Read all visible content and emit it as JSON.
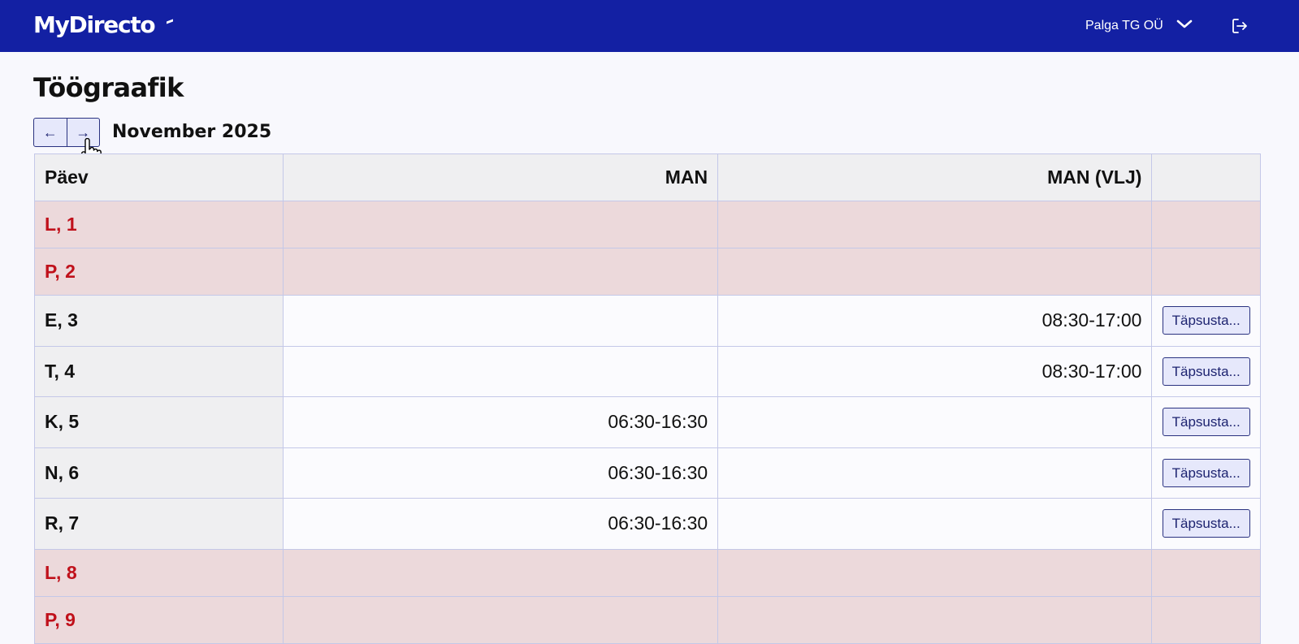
{
  "header": {
    "logo_text": "MyDirecto",
    "company_name": "Palga TG OÜ",
    "background_color": "#1320a3",
    "company_dropdown_icon": "chevron-down-icon",
    "logout_icon": "logout-icon"
  },
  "page": {
    "title": "Töögraafik",
    "prev_label": "←",
    "next_label": "→",
    "month": "November 2025"
  },
  "table": {
    "columns": [
      "Päev",
      "MAN",
      "MAN (VLJ)",
      ""
    ],
    "refine_label": "Täpsusta...",
    "rows": [
      {
        "day": "L, 1",
        "man": "",
        "man_vlj": "",
        "weekend": true
      },
      {
        "day": "P, 2",
        "man": "",
        "man_vlj": "",
        "weekend": true
      },
      {
        "day": "E, 3",
        "man": "",
        "man_vlj": "08:30-17:00",
        "weekend": false
      },
      {
        "day": "T, 4",
        "man": "",
        "man_vlj": "08:30-17:00",
        "weekend": false
      },
      {
        "day": "K, 5",
        "man": "06:30-16:30",
        "man_vlj": "",
        "weekend": false
      },
      {
        "day": "N, 6",
        "man": "06:30-16:30",
        "man_vlj": "",
        "weekend": false
      },
      {
        "day": "R, 7",
        "man": "06:30-16:30",
        "man_vlj": "",
        "weekend": false
      },
      {
        "day": "L, 8",
        "man": "",
        "man_vlj": "",
        "weekend": true
      },
      {
        "day": "P, 9",
        "man": "",
        "man_vlj": "",
        "weekend": true
      }
    ]
  },
  "colors": {
    "weekend_row": "#ecd9db",
    "weekend_text": "#c0111b",
    "button_bg": "#e6e8fb",
    "button_border": "#2a3280"
  }
}
